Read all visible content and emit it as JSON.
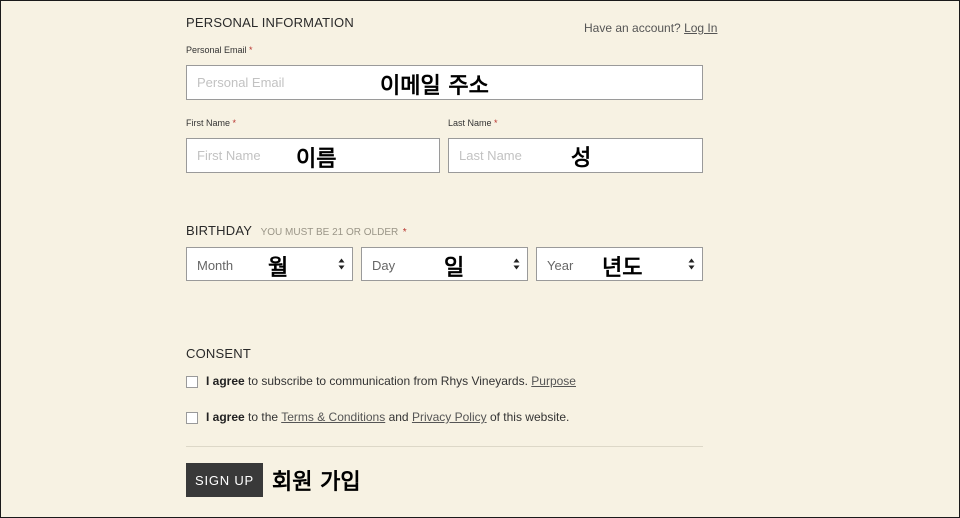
{
  "personal": {
    "title": "PERSONAL INFORMATION",
    "have_account": "Have an account?",
    "login_label": "Log In",
    "email_label": "Personal Email",
    "email_placeholder": "Personal Email",
    "first_name_label": "First Name",
    "first_name_placeholder": "First Name",
    "last_name_label": "Last Name",
    "last_name_placeholder": "Last Name",
    "required_mark": "*"
  },
  "birthday": {
    "title": "BIRTHDAY",
    "note": "YOU MUST BE 21 OR OLDER",
    "month_placeholder": "Month",
    "day_placeholder": "Day",
    "year_placeholder": "Year"
  },
  "consent": {
    "title": "CONSENT",
    "item1": {
      "agree": "I agree",
      "text": " to subscribe to communication from Rhys Vineyards. ",
      "link": "Purpose"
    },
    "item2": {
      "agree": "I agree",
      "text_before": " to the ",
      "link1": "Terms & Conditions",
      "text_mid": " and ",
      "link2": "Privacy Policy",
      "text_after": " of this website."
    }
  },
  "signup_label": "SIGN UP",
  "annotations": {
    "email": "이메일 주소",
    "first_name": "이름",
    "last_name": "성",
    "month": "월",
    "day": "일",
    "year": "년도",
    "signup": "회원 가입"
  }
}
